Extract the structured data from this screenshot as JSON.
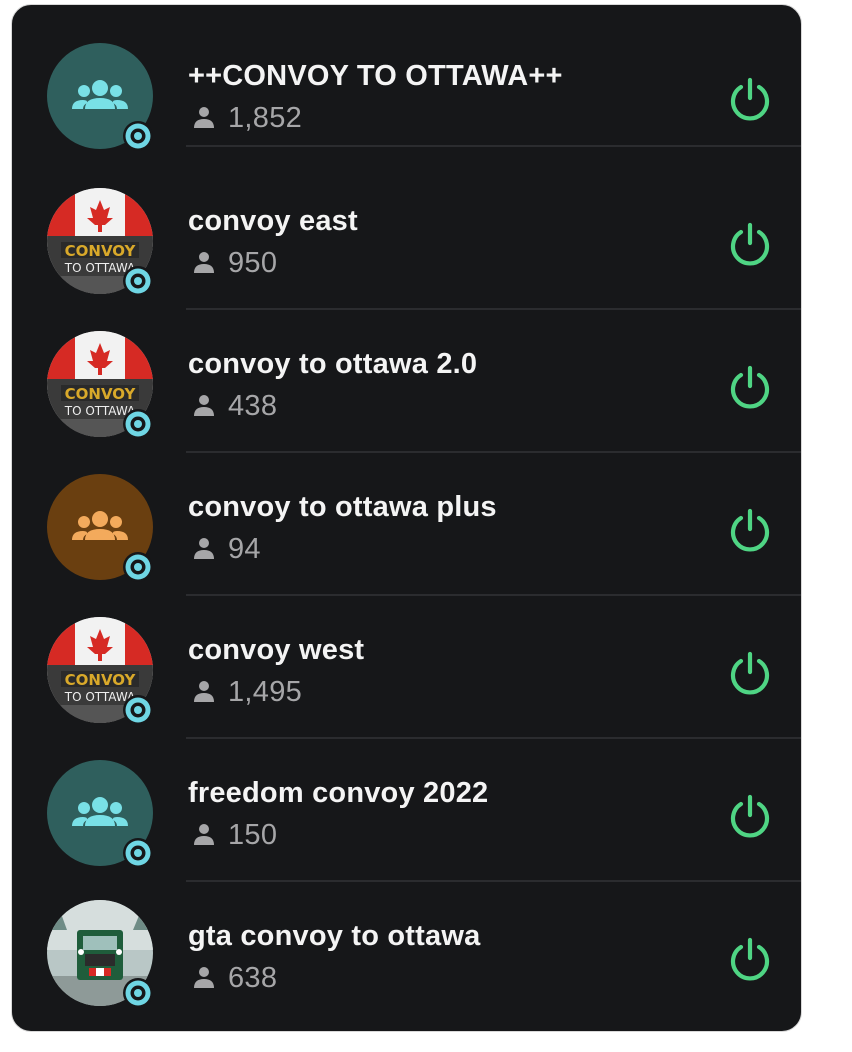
{
  "colors": {
    "panel_bg": "#161719",
    "divider": "#2b2c2f",
    "power_green": "#4fd584",
    "badge_cyan": "#6fd6e4",
    "avatar_teal": "#2f5f5d",
    "avatar_brown": "#6a3f10"
  },
  "channels": [
    {
      "name": "++CONVOY TO OTTAWA++",
      "members": "1,852",
      "avatar": "group-icon-teal"
    },
    {
      "name": "convoy east",
      "members": "950",
      "avatar": "convoy-flag-image"
    },
    {
      "name": "convoy to ottawa 2.0",
      "members": "438",
      "avatar": "convoy-flag-image"
    },
    {
      "name": "convoy to ottawa plus",
      "members": "94",
      "avatar": "group-icon-brown"
    },
    {
      "name": "convoy west",
      "members": "1,495",
      "avatar": "convoy-flag-image"
    },
    {
      "name": "freedom convoy 2022",
      "members": "150",
      "avatar": "group-icon-teal"
    },
    {
      "name": "gta convoy to ottawa",
      "members": "638",
      "avatar": "truck-photo"
    }
  ],
  "icons": {
    "member": "person-icon",
    "action": "power-icon",
    "badge": "channel-badge-icon"
  }
}
